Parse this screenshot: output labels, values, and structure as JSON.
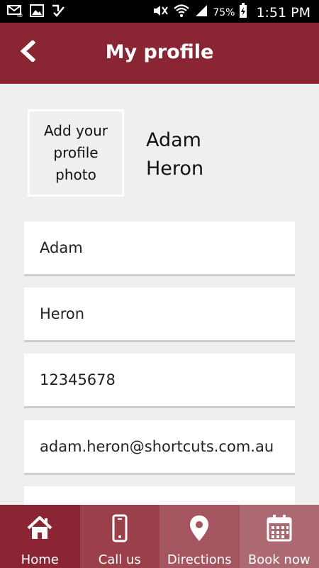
{
  "status": {
    "battery": "75%",
    "time": "1:51 PM"
  },
  "header": {
    "title": "My profile"
  },
  "profile": {
    "photo_prompt": "Add your profile photo",
    "first_name_display": "Adam",
    "last_name_display": "Heron"
  },
  "fields": {
    "first_name": "Adam",
    "last_name": "Heron",
    "phone": "12345678",
    "email": "adam.heron@shortcuts.com.au",
    "extra": ""
  },
  "tabs": [
    {
      "label": "Home",
      "icon": "home-icon"
    },
    {
      "label": "Call us",
      "icon": "phone-icon"
    },
    {
      "label": "Directions",
      "icon": "location-pin-icon"
    },
    {
      "label": "Book now",
      "icon": "calendar-icon"
    }
  ],
  "colors": {
    "brand": "#8a2634",
    "background": "#efefef"
  }
}
